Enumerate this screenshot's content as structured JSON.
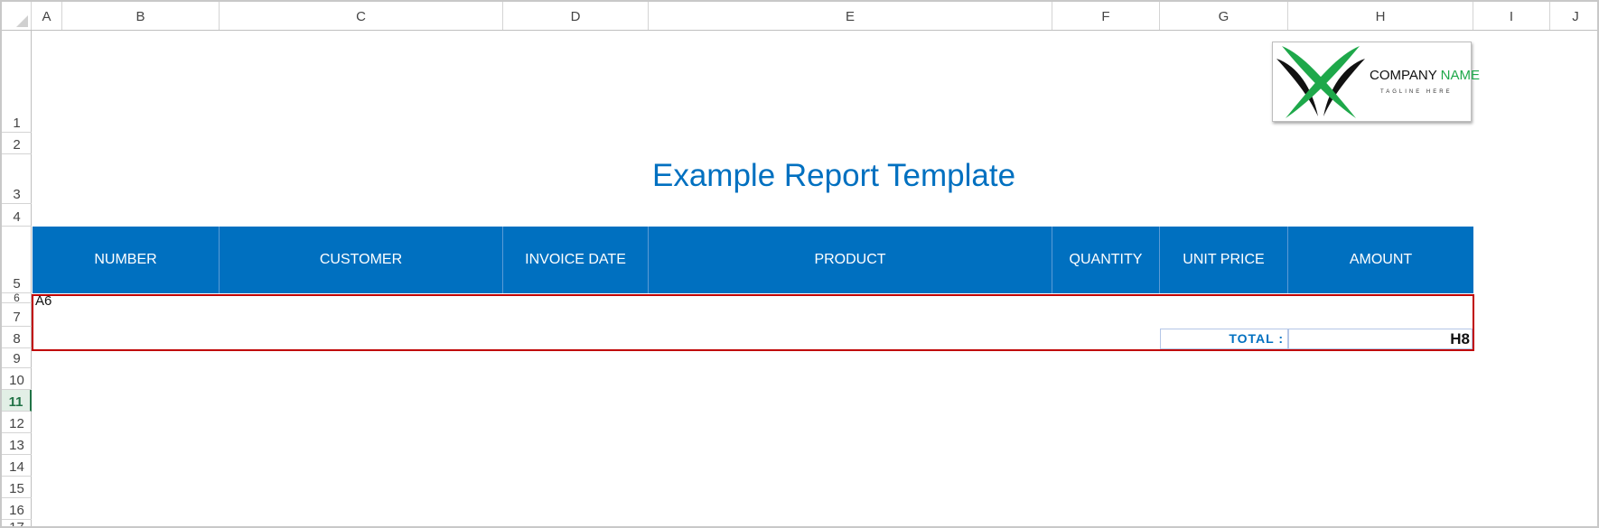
{
  "columns": [
    "A",
    "B",
    "C",
    "D",
    "E",
    "F",
    "G",
    "H",
    "I",
    "J"
  ],
  "rows": [
    "1",
    "2",
    "3",
    "4",
    "5",
    "6",
    "7",
    "8",
    "9",
    "10",
    "11",
    "12",
    "13",
    "14",
    "15",
    "16",
    "17"
  ],
  "active_row": "11",
  "logo": {
    "name_part1": "COMPANY ",
    "name_part2": "NAME",
    "tagline": "TAGLINE HERE",
    "accent_color": "#1ea84a"
  },
  "title": "Example Report Template",
  "table": {
    "headers": [
      "NUMBER",
      "CUSTOMER",
      "INVOICE DATE",
      "PRODUCT",
      "QUANTITY",
      "UNIT PRICE",
      "AMOUNT"
    ],
    "header_color": "#0070c0"
  },
  "cells": {
    "a6": "A6",
    "total_label": "TOTAL :",
    "total_value": "H8"
  },
  "selection_color": "#c00000"
}
